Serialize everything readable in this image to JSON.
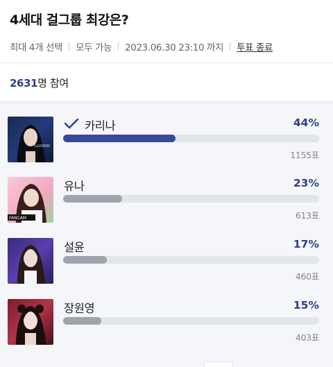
{
  "poll": {
    "title": "4세대 걸그룹 최강은?",
    "meta": {
      "max_select": "최대 4개 선택",
      "anyone": "모두 가능",
      "deadline": "2023.06.30 23:10 까지",
      "end_vote": "투표 종료"
    },
    "participants_count": "2631",
    "participants_suffix": "명 참여",
    "options": [
      {
        "name": "카리나",
        "percent_label": "44%",
        "percent": 44,
        "votes": "1155표",
        "checked": true,
        "bar_color": "#3a4a9a",
        "thumb_caption": "ILLUSION"
      },
      {
        "name": "유나",
        "percent_label": "23%",
        "percent": 23,
        "votes": "613표",
        "checked": false,
        "bar_color": "#9fa3ab",
        "thumb_caption": "FANCAM"
      },
      {
        "name": "설윤",
        "percent_label": "17%",
        "percent": 17,
        "votes": "460표",
        "checked": false,
        "bar_color": "#9fa3ab",
        "thumb_caption": ""
      },
      {
        "name": "장원영",
        "percent_label": "15%",
        "percent": 15,
        "votes": "403표",
        "checked": false,
        "bar_color": "#9fa3ab",
        "thumb_caption": ""
      }
    ]
  },
  "colors": {
    "accent": "#2f3f8f",
    "bar_track": "#e2e5ec",
    "section_bg": "#f4f6fa"
  },
  "icons": {
    "checked": "check-icon"
  }
}
